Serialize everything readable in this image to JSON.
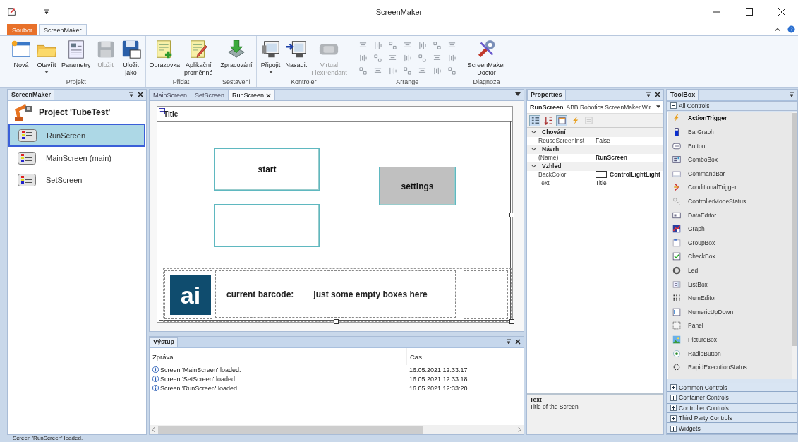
{
  "window": {
    "title": "ScreenMaker"
  },
  "ribbon": {
    "tabs": [
      {
        "label": "Soubor",
        "kind": "file",
        "selected": false
      },
      {
        "label": "ScreenMaker",
        "kind": "tab",
        "selected": true
      }
    ],
    "groups": [
      {
        "label": "Projekt",
        "buttons": [
          {
            "lines": [
              "Nová"
            ],
            "disabled": false,
            "dropdown": false
          },
          {
            "lines": [
              "Otevřít"
            ],
            "disabled": false,
            "dropdown": true
          },
          {
            "lines": [
              "Parametry"
            ],
            "disabled": false,
            "dropdown": false
          },
          {
            "lines": [
              "Uložit"
            ],
            "disabled": true,
            "dropdown": false
          },
          {
            "lines": [
              "Uložit",
              "jako"
            ],
            "disabled": false,
            "dropdown": false
          }
        ]
      },
      {
        "label": "Přidat",
        "buttons": [
          {
            "lines": [
              "Obrazovka"
            ],
            "disabled": false,
            "dropdown": false
          },
          {
            "lines": [
              "Aplikační",
              "proměnné"
            ],
            "disabled": false,
            "dropdown": false
          }
        ]
      },
      {
        "label": "Sestavení",
        "buttons": [
          {
            "lines": [
              "Zpracování"
            ],
            "disabled": false,
            "dropdown": false
          }
        ]
      },
      {
        "label": "Kontroler",
        "buttons": [
          {
            "lines": [
              "Připojit"
            ],
            "disabled": false,
            "dropdown": true
          },
          {
            "lines": [
              "Nasadit"
            ],
            "disabled": false,
            "dropdown": false
          },
          {
            "lines": [
              "Virtual",
              "FlexPendant"
            ],
            "disabled": true,
            "dropdown": false
          }
        ]
      },
      {
        "label": "Arrange",
        "kind": "grid"
      },
      {
        "label": "Diagnoza",
        "buttons": [
          {
            "lines": [
              "ScreenMaker",
              "Doctor"
            ],
            "disabled": false,
            "dropdown": false
          }
        ]
      }
    ]
  },
  "explorer": {
    "tab": "ScreenMaker",
    "project": "Project 'TubeTest'",
    "items": [
      {
        "label": "RunScreen",
        "selected": true
      },
      {
        "label": "MainScreen (main)",
        "selected": false
      },
      {
        "label": "SetScreen",
        "selected": false
      }
    ]
  },
  "editor": {
    "tabs": [
      {
        "label": "MainScreen",
        "selected": false
      },
      {
        "label": "SetScreen",
        "selected": false
      },
      {
        "label": "RunScreen",
        "selected": true
      }
    ],
    "form_title": "Title",
    "controls": [
      {
        "kind": "button",
        "text": "start",
        "color": "#ffffff"
      },
      {
        "kind": "button",
        "text": "settings",
        "color": "#c0c0c0"
      },
      {
        "kind": "button",
        "color": "#ffffff"
      },
      {
        "kind": "logo",
        "text": "ai"
      },
      {
        "kind": "panel",
        "texts": [
          "current barcode:",
          "just some empty boxes here"
        ]
      },
      {
        "kind": "panel"
      }
    ]
  },
  "output": {
    "tab": "Výstup",
    "columns": [
      "Zpráva",
      "Čas"
    ],
    "rows": [
      {
        "message": "Screen 'MainScreen' loaded.",
        "time": "16.05.2021 12:33:17"
      },
      {
        "message": "Screen 'SetScreen' loaded.",
        "time": "16.05.2021 12:33:18"
      },
      {
        "message": "Screen 'RunScreen' loaded.",
        "time": "16.05.2021 12:33:20"
      }
    ]
  },
  "properties": {
    "tab": "Properties",
    "object_name": "RunScreen",
    "object_type": "ABB.Robotics.ScreenMaker.Wir",
    "toolbar": [
      {
        "kind": "categorized",
        "selected": true,
        "disabled": false
      },
      {
        "kind": "alphabetical",
        "selected": false,
        "disabled": false
      },
      {
        "kind": "properties",
        "selected": true,
        "disabled": false
      },
      {
        "kind": "events",
        "selected": false,
        "disabled": false
      },
      {
        "kind": "pages",
        "selected": false,
        "disabled": true
      }
    ],
    "categories": [
      {
        "name": "Chování",
        "expanded": true,
        "rows": [
          {
            "name": "ReuseScreenInst",
            "value": "False",
            "bold": false
          }
        ]
      },
      {
        "name": "Návrh",
        "expanded": true,
        "rows": [
          {
            "name": "(Name)",
            "value": "RunScreen",
            "bold": true
          }
        ]
      },
      {
        "name": "Vzhled",
        "expanded": true,
        "rows": [
          {
            "name": "BackColor",
            "value": "ControlLightLight",
            "bold": true,
            "color": "#ffffff"
          },
          {
            "name": "Text",
            "value": "Title",
            "bold": false
          }
        ]
      }
    ],
    "help_title": "Text",
    "help_text": "Title of the Screen"
  },
  "toolbox": {
    "tab": "ToolBox",
    "group": "All Controls",
    "items": [
      {
        "label": "ActionTrigger",
        "selected": true
      },
      {
        "label": "BarGraph",
        "selected": false
      },
      {
        "label": "Button",
        "selected": false
      },
      {
        "label": "ComboBox",
        "selected": false
      },
      {
        "label": "CommandBar",
        "selected": false
      },
      {
        "label": "ConditionalTrigger",
        "selected": false
      },
      {
        "label": "ControllerModeStatus",
        "selected": false
      },
      {
        "label": "DataEditor",
        "selected": false
      },
      {
        "label": "Graph",
        "selected": false
      },
      {
        "label": "GroupBox",
        "selected": false
      },
      {
        "label": "CheckBox",
        "selected": false
      },
      {
        "label": "Led",
        "selected": false
      },
      {
        "label": "ListBox",
        "selected": false
      },
      {
        "label": "NumEditor",
        "selected": false
      },
      {
        "label": "NumericUpDown",
        "selected": false
      },
      {
        "label": "Panel",
        "selected": false
      },
      {
        "label": "PictureBox",
        "selected": false
      },
      {
        "label": "RadioButton",
        "selected": false
      },
      {
        "label": "RapidExecutionStatus",
        "selected": false
      }
    ],
    "sections": [
      "Common Controls",
      "Container Controls",
      "Controller Controls",
      "Third Party Controls",
      "Widgets"
    ]
  },
  "status_bar": "Screen 'RunScreen' loaded."
}
